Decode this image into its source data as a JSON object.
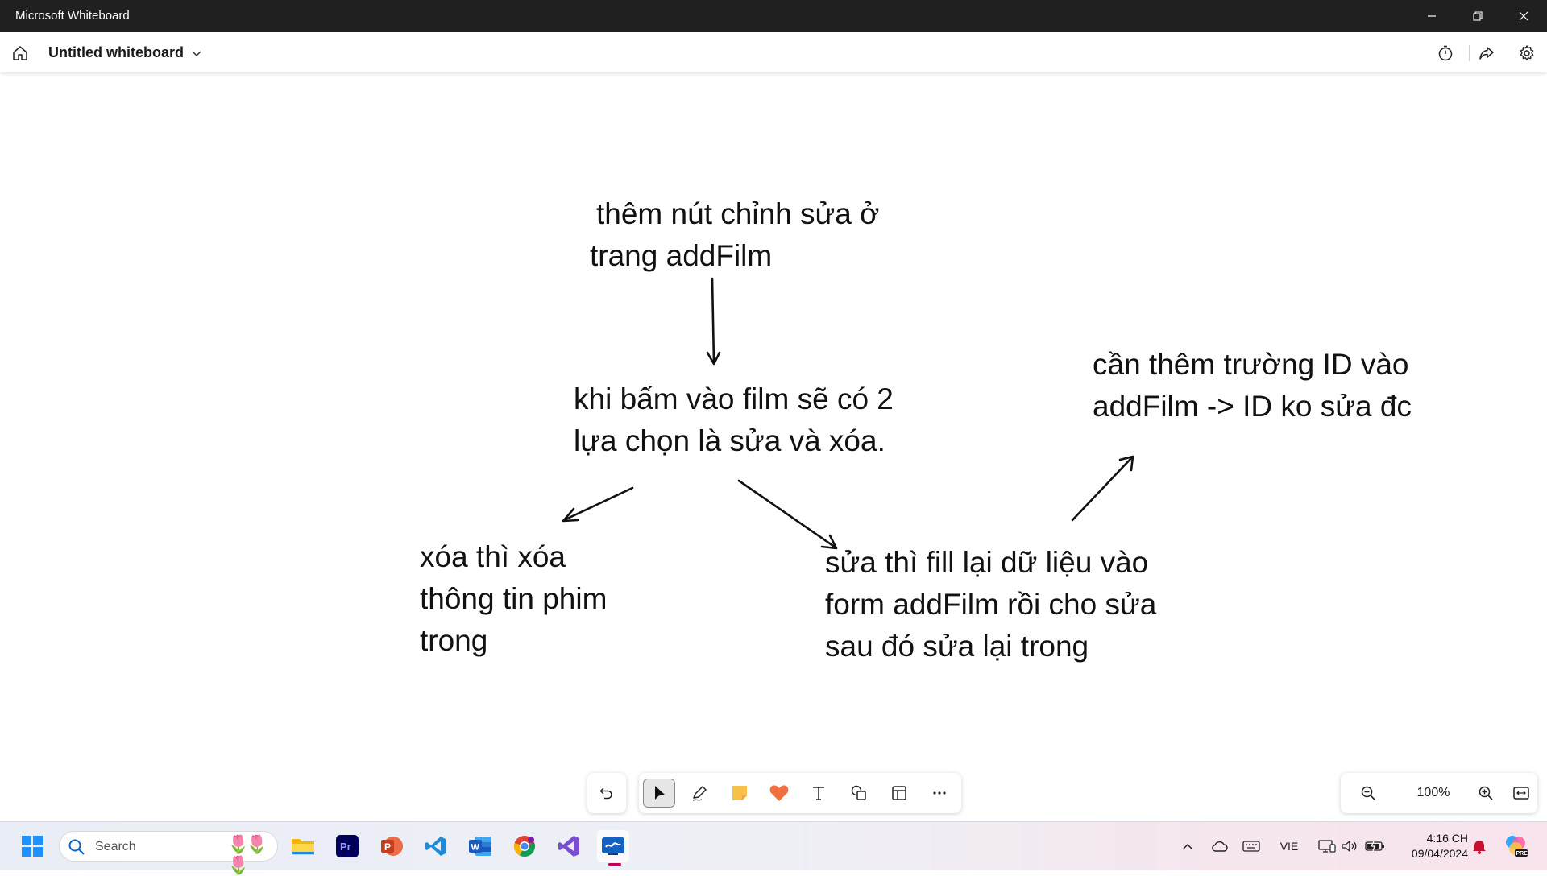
{
  "window": {
    "app_title": "Microsoft Whiteboard",
    "minimize_icon": "minimize-icon",
    "restore_icon": "restore-icon",
    "close_icon": "close-icon"
  },
  "header": {
    "board_title": "Untitled whiteboard",
    "right_icons": [
      "timer-icon",
      "share-icon",
      "settings-icon"
    ]
  },
  "notes": [
    {
      "id": "note-top",
      "lines": [
        "thêm nút chỉnh sửa ở",
        "trang addFilm"
      ]
    },
    {
      "id": "note-center",
      "lines": [
        "khi bấm vào film sẽ có 2",
        "lựa chọn là sửa và xóa."
      ]
    },
    {
      "id": "note-right",
      "lines": [
        "cần thêm trường ID vào",
        "addFilm -> ID ko sửa đc"
      ]
    },
    {
      "id": "note-left",
      "lines": [
        "xóa thì xóa",
        "thông tin phim",
        "trong"
      ]
    },
    {
      "id": "note-bottom",
      "lines": [
        "sửa thì fill lại dữ liệu vào",
        "form addFilm rồi cho sửa",
        "sau đó sửa lại trong"
      ]
    }
  ],
  "toolbar": {
    "undo_icon": "undo-icon",
    "tools": [
      "select-icon",
      "pen-icon",
      "sticky-note-icon",
      "reaction-icon",
      "text-icon",
      "shapes-icon",
      "templates-icon",
      "more-icon"
    ],
    "active_tool": "select-icon"
  },
  "zoom": {
    "level": "100%"
  },
  "taskbar": {
    "search_placeholder": "Search",
    "pinned": [
      "windows-start-icon",
      "file-explorer-icon",
      "premiere-pro-icon",
      "powerpoint-icon",
      "vscode-icon",
      "word-icon",
      "chrome-icon",
      "visual-studio-icon",
      "whiteboard-icon"
    ],
    "active_app": "whiteboard-icon",
    "language": "VIE",
    "time": "4:16 CH",
    "date": "09/04/2024"
  },
  "colors": {
    "titlebar": "#202020",
    "ink": "#111111",
    "sticky": "#f7c04a",
    "heart": "#f07040",
    "active_indicator": "#c0005a"
  }
}
